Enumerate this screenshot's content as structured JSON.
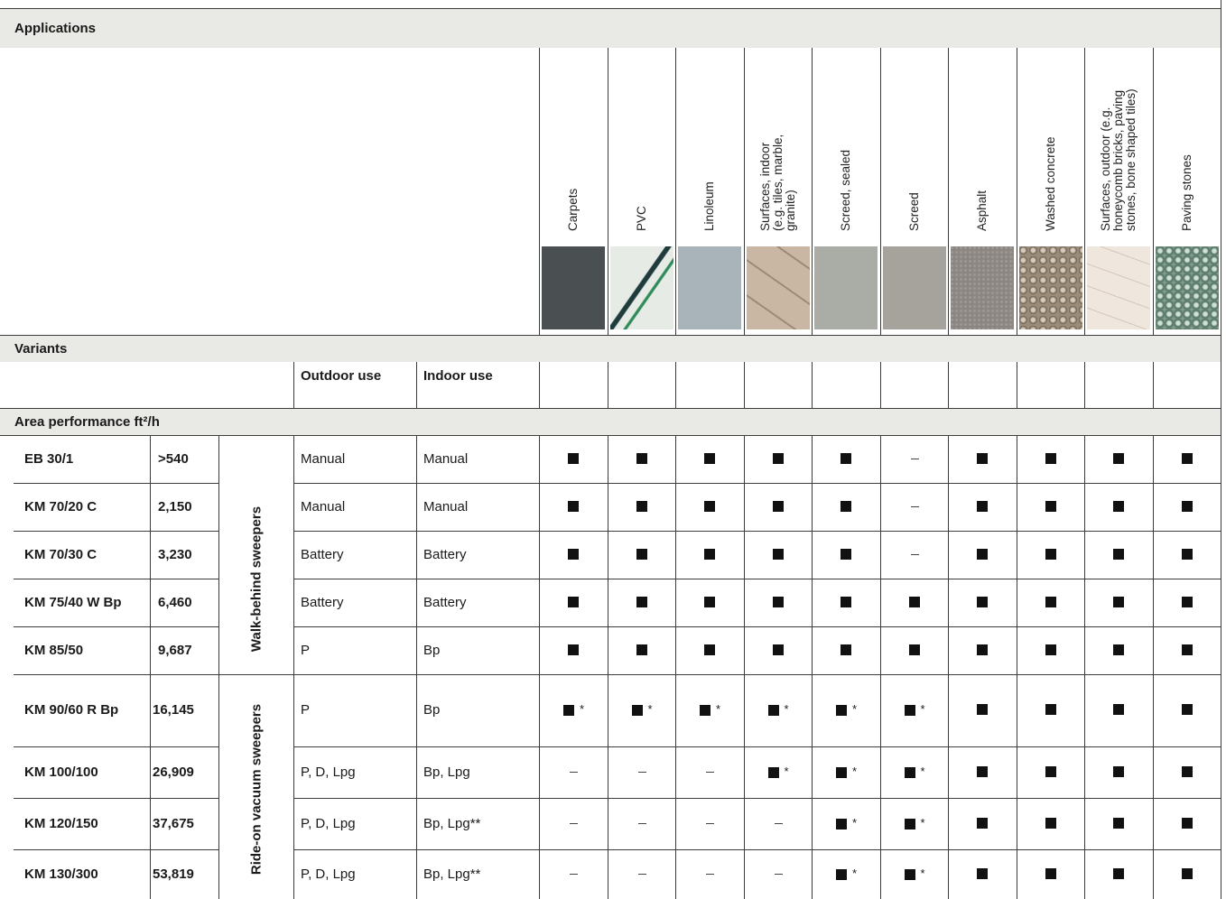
{
  "sections": {
    "applications": "Applications",
    "variants": "Variants",
    "area": "Area performance ft²/h"
  },
  "variant_headers": {
    "outdoor": "Outdoor use",
    "indoor": "Indoor use"
  },
  "surfaces": [
    {
      "label": "Carpets",
      "icon": "carpet-swatch",
      "color": "#4a4f52"
    },
    {
      "label": "PVC",
      "icon": "pvc-swatch",
      "color": "#e6ebe6"
    },
    {
      "label": "Linoleum",
      "icon": "linoleum-swatch",
      "color": "#a9b3ba"
    },
    {
      "label": "Surfaces, indoor\n(e.g. tiles, marble,\ngranite)",
      "icon": "tile-swatch",
      "color": "#c5b39f"
    },
    {
      "label": "Screed, sealed",
      "icon": "screed-sealed-swatch",
      "color": "#a9ada6"
    },
    {
      "label": "Screed",
      "icon": "screed-swatch",
      "color": "#a6a39d"
    },
    {
      "label": "Asphalt",
      "icon": "asphalt-swatch",
      "color": "#8b8682"
    },
    {
      "label": "Washed concrete",
      "icon": "washed-concrete-swatch",
      "color": "#9a8c78"
    },
    {
      "label": "Surfaces, outdoor (e.g.\nhoneycomb bricks, paving\nstones, bone shaped tiles)",
      "icon": "brick-swatch",
      "color": "#eadfd6"
    },
    {
      "label": "Paving stones",
      "icon": "paving-swatch",
      "color": "#7f9c8b"
    }
  ],
  "groups": [
    {
      "label": "Walk-behind sweepers"
    },
    {
      "label": "Ride-on vacuum sweepers"
    }
  ],
  "rows": [
    {
      "model": "EB 30/1",
      "area": ">540",
      "outdoor": "Manual",
      "indoor": "Manual",
      "marks": [
        "sq",
        "sq",
        "sq",
        "sq",
        "sq",
        "dash",
        "sq",
        "sq",
        "sq",
        "sq"
      ]
    },
    {
      "model": "KM 70/20 C",
      "area": "2,150",
      "outdoor": "Manual",
      "indoor": "Manual",
      "marks": [
        "sq",
        "sq",
        "sq",
        "sq",
        "sq",
        "dash",
        "sq",
        "sq",
        "sq",
        "sq"
      ]
    },
    {
      "model": "KM 70/30 C",
      "area": "3,230",
      "outdoor": "Battery",
      "indoor": "Battery",
      "marks": [
        "sq",
        "sq",
        "sq",
        "sq",
        "sq",
        "dash",
        "sq",
        "sq",
        "sq",
        "sq"
      ]
    },
    {
      "model": "KM 75/40 W Bp",
      "area": "6,460",
      "outdoor": "Battery",
      "indoor": "Battery",
      "marks": [
        "sq",
        "sq",
        "sq",
        "sq",
        "sq",
        "sq",
        "sq",
        "sq",
        "sq",
        "sq"
      ]
    },
    {
      "model": "KM 85/50",
      "area": "9,687",
      "outdoor": "P",
      "indoor": "Bp",
      "marks": [
        "sq",
        "sq",
        "sq",
        "sq",
        "sq",
        "sq",
        "sq",
        "sq",
        "sq",
        "sq"
      ]
    },
    {
      "model": "KM 90/60 R Bp",
      "area": "16,145",
      "outdoor": "P",
      "indoor": "Bp",
      "marks": [
        "sq*",
        "sq*",
        "sq*",
        "sq*",
        "sq*",
        "sq*",
        "sq",
        "sq",
        "sq",
        "sq"
      ]
    },
    {
      "model": "KM 100/100",
      "area": "26,909",
      "outdoor": "P, D, Lpg",
      "indoor": "Bp, Lpg",
      "marks": [
        "dash",
        "dash",
        "dash",
        "sq*",
        "sq*",
        "sq*",
        "sq",
        "sq",
        "sq",
        "sq"
      ]
    },
    {
      "model": "KM 120/150",
      "area": "37,675",
      "outdoor": "P, D, Lpg",
      "indoor": "Bp, Lpg**",
      "marks": [
        "dash",
        "dash",
        "dash",
        "dash",
        "sq*",
        "sq*",
        "sq",
        "sq",
        "sq",
        "sq"
      ]
    },
    {
      "model": "KM 130/300",
      "area": "53,819",
      "outdoor": "P, D, Lpg",
      "indoor": "Bp, Lpg**",
      "marks": [
        "dash",
        "dash",
        "dash",
        "dash",
        "sq*",
        "sq*",
        "sq",
        "sq",
        "sq",
        "sq"
      ]
    }
  ],
  "symbols": {
    "star": "*"
  }
}
